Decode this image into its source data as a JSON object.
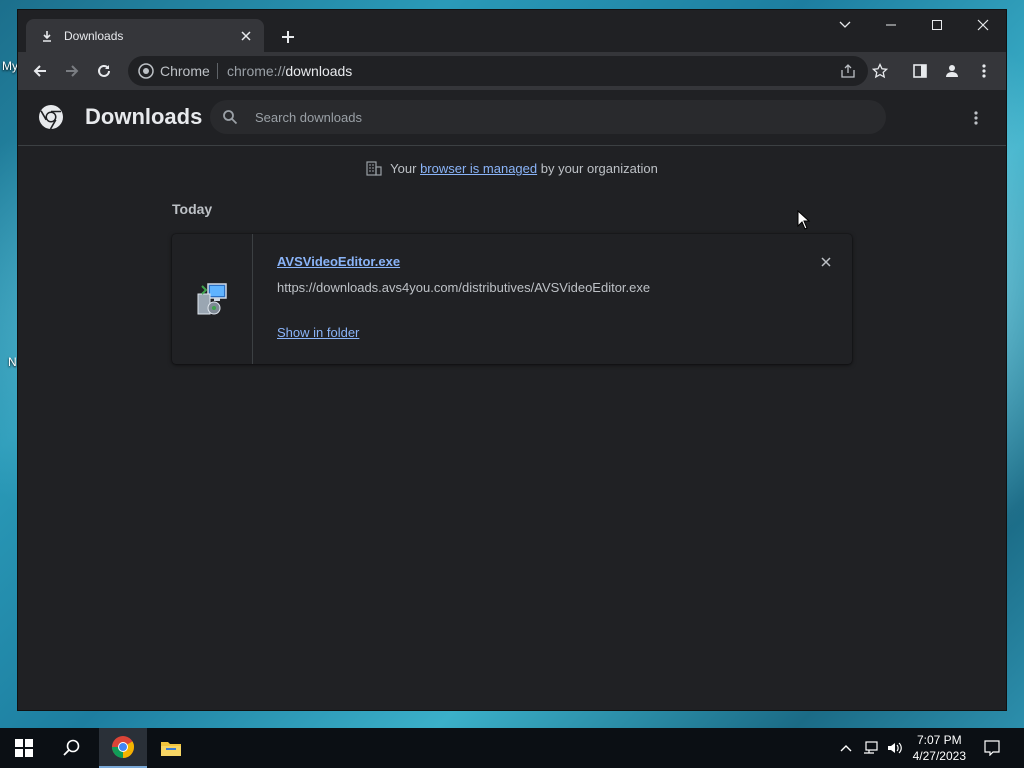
{
  "desktop": {
    "icon_labels": [
      "My",
      "N"
    ]
  },
  "browser": {
    "tab": {
      "title": "Downloads",
      "icon": "download-icon"
    },
    "new_tab_icon": "plus-icon",
    "window_controls": [
      "chevron-down-icon",
      "minimize-icon",
      "maximize-icon",
      "close-icon"
    ],
    "omnibox": {
      "site_label": "Chrome",
      "url_prefix": "chrome://",
      "url_host": "downloads"
    }
  },
  "downloads_page": {
    "title": "Downloads",
    "search": {
      "placeholder": "Search downloads"
    },
    "managed_notice": {
      "before": "Your ",
      "link": "browser is managed",
      "after": " by your organization"
    },
    "sections": [
      {
        "date": "Today",
        "items": [
          {
            "file_name": "AVSVideoEditor.exe",
            "url": "https://downloads.avs4you.com/distributives/AVSVideoEditor.exe",
            "action_label": "Show in folder",
            "icon": "installer-icon"
          }
        ]
      }
    ]
  },
  "taskbar": {
    "items": [
      "windows-start-icon",
      "search-icon",
      "chrome-icon",
      "file-explorer-icon"
    ],
    "clock": {
      "time": "7:07 PM",
      "date": "4/27/2023"
    }
  },
  "colors": {
    "window_bg": "#202124",
    "toolbar_bg": "#35363a",
    "link": "#8ab4f8",
    "text": "#e8eaed"
  }
}
